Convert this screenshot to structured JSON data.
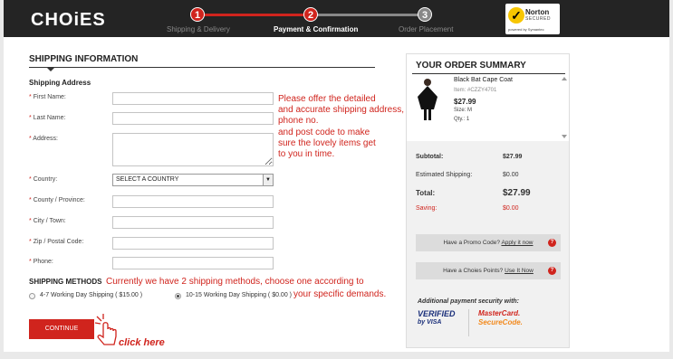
{
  "header": {
    "logo": "CHOiES",
    "steps": [
      {
        "num": "1",
        "label": "Shipping & Delivery",
        "state": "done"
      },
      {
        "num": "2",
        "label": "Payment & Confirmation",
        "state": "active"
      },
      {
        "num": "3",
        "label": "Order Placement",
        "state": "todo"
      }
    ],
    "norton": {
      "line1": "Norton",
      "line2": "SECURED",
      "line3": "powered by Symantec"
    }
  },
  "form": {
    "section_title": "SHIPPING INFORMATION",
    "subsection_title": "Shipping Address",
    "fields": {
      "first_name": {
        "label": "First Name:",
        "value": ""
      },
      "last_name": {
        "label": "Last Name:",
        "value": ""
      },
      "address": {
        "label": "Address:",
        "value": ""
      },
      "country": {
        "label": "Country:",
        "value": "SELECT A COUNTRY"
      },
      "county": {
        "label": "County / Province:",
        "value": ""
      },
      "city": {
        "label": "City / Town:",
        "value": ""
      },
      "zip": {
        "label": "Zip / Postal Code:",
        "value": ""
      },
      "phone": {
        "label": "Phone:",
        "value": ""
      }
    },
    "required_mark": "*",
    "note_lines": [
      "Please offer the detailed",
      "and accurate shipping address,",
      "phone no.",
      "and post code to make",
      "sure the lovely items get",
      "to you in time."
    ],
    "shipping_methods_title": "SHIPPING METHODS",
    "methods_note_line1": "Currently we have 2 shipping methods, choose one according to",
    "methods_note_line2": "your specific demands.",
    "methods": [
      {
        "label": "4-7 Working Day Shipping ( $15.00 )",
        "selected": false
      },
      {
        "label": "10-15 Working Day Shipping ( $0.00 )",
        "selected": true
      }
    ],
    "continue_label": "CONTINUE",
    "click_here": "click here"
  },
  "summary": {
    "title": "YOUR ORDER SUMMARY",
    "product": {
      "name": "Black Bat Cape Coat",
      "item": "Item: #CZZY4701",
      "price": "$27.99",
      "size": "Size: M",
      "qty": "Qty.: 1"
    },
    "totals": {
      "subtotal_label": "Subtotal:",
      "subtotal_value": "$27.99",
      "shipping_label": "Estimated Shipping:",
      "shipping_value": "$0.00",
      "total_label": "Total:",
      "total_value": "$27.99",
      "saving_label": "Saving:",
      "saving_value": "$0.00"
    },
    "promo_text": "Have a Promo Code?",
    "promo_link": "Apply it now",
    "points_text": "Have a Choies Points?",
    "points_link": "Use It Now",
    "security_title": "Additional payment security with:",
    "visa_line1": "VERIFIED",
    "visa_line2": "by VISA",
    "mc_line1": "MasterCard.",
    "mc_line2": "SecureCode."
  },
  "colors": {
    "accent": "#d0241d",
    "dark": "#242424",
    "step_todo": "#888888"
  }
}
